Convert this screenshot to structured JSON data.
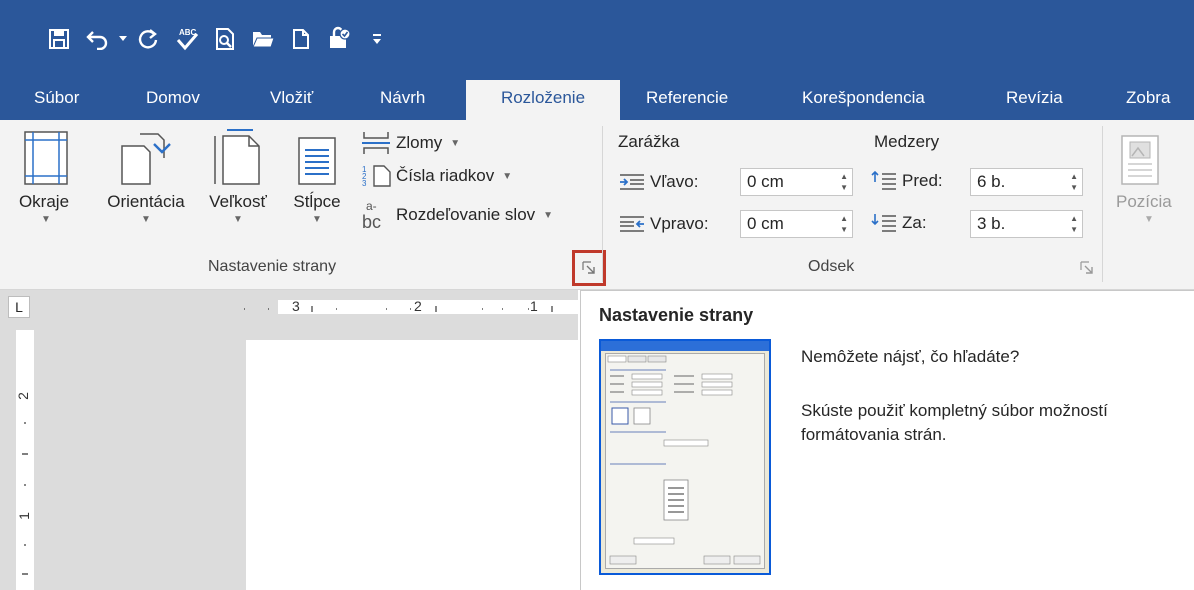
{
  "quick_access": {
    "icons": [
      "save-icon",
      "undo-icon",
      "undo-dropdown-icon",
      "redo-icon",
      "spelling-icon",
      "print-preview-icon",
      "open-folder-icon",
      "new-document-icon",
      "protect-icon",
      "customize-qat-icon"
    ]
  },
  "tabs": [
    {
      "label": "Súbor"
    },
    {
      "label": "Domov"
    },
    {
      "label": "Vložiť"
    },
    {
      "label": "Návrh"
    },
    {
      "label": "Rozloženie"
    },
    {
      "label": "Referencie"
    },
    {
      "label": "Korešpondencia"
    },
    {
      "label": "Revízia"
    },
    {
      "label": "Zobra"
    }
  ],
  "active_tab": "Rozloženie",
  "ribbon": {
    "page_setup": {
      "margins_label": "Okraje",
      "orientation_label": "Orientácia",
      "size_label": "Veľkosť",
      "columns_label": "Stĺpce",
      "breaks_label": "Zlomy",
      "line_numbers_label": "Čísla riadkov",
      "hyphenation_label": "Rozdeľovanie slov",
      "group_label": "Nastavenie strany"
    },
    "paragraph": {
      "indent_title": "Zarážka",
      "spacing_title": "Medzery",
      "left_label": "Vľavo:",
      "left_value": "0 cm",
      "right_label": "Vpravo:",
      "right_value": "0 cm",
      "before_label": "Pred:",
      "before_value": "6 b.",
      "after_label": "Za:",
      "after_value": "3 b.",
      "group_label": "Odsek"
    },
    "arrange": {
      "position_label": "Pozícia"
    }
  },
  "ruler": {
    "numbers": [
      "3",
      "2",
      "1"
    ],
    "vertical_numbers": [
      "2",
      "1"
    ],
    "corner_symbol": "L"
  },
  "tooltip": {
    "title": "Nastavenie strany",
    "line1": "Nemôžete nájsť, čo hľadáte?",
    "line2": "Skúste použiť kompletný súbor možností formátovania strán."
  },
  "colors": {
    "title_bar": "#2b579a",
    "ribbon": "#f3f3f3",
    "highlight": "#c0392b"
  }
}
